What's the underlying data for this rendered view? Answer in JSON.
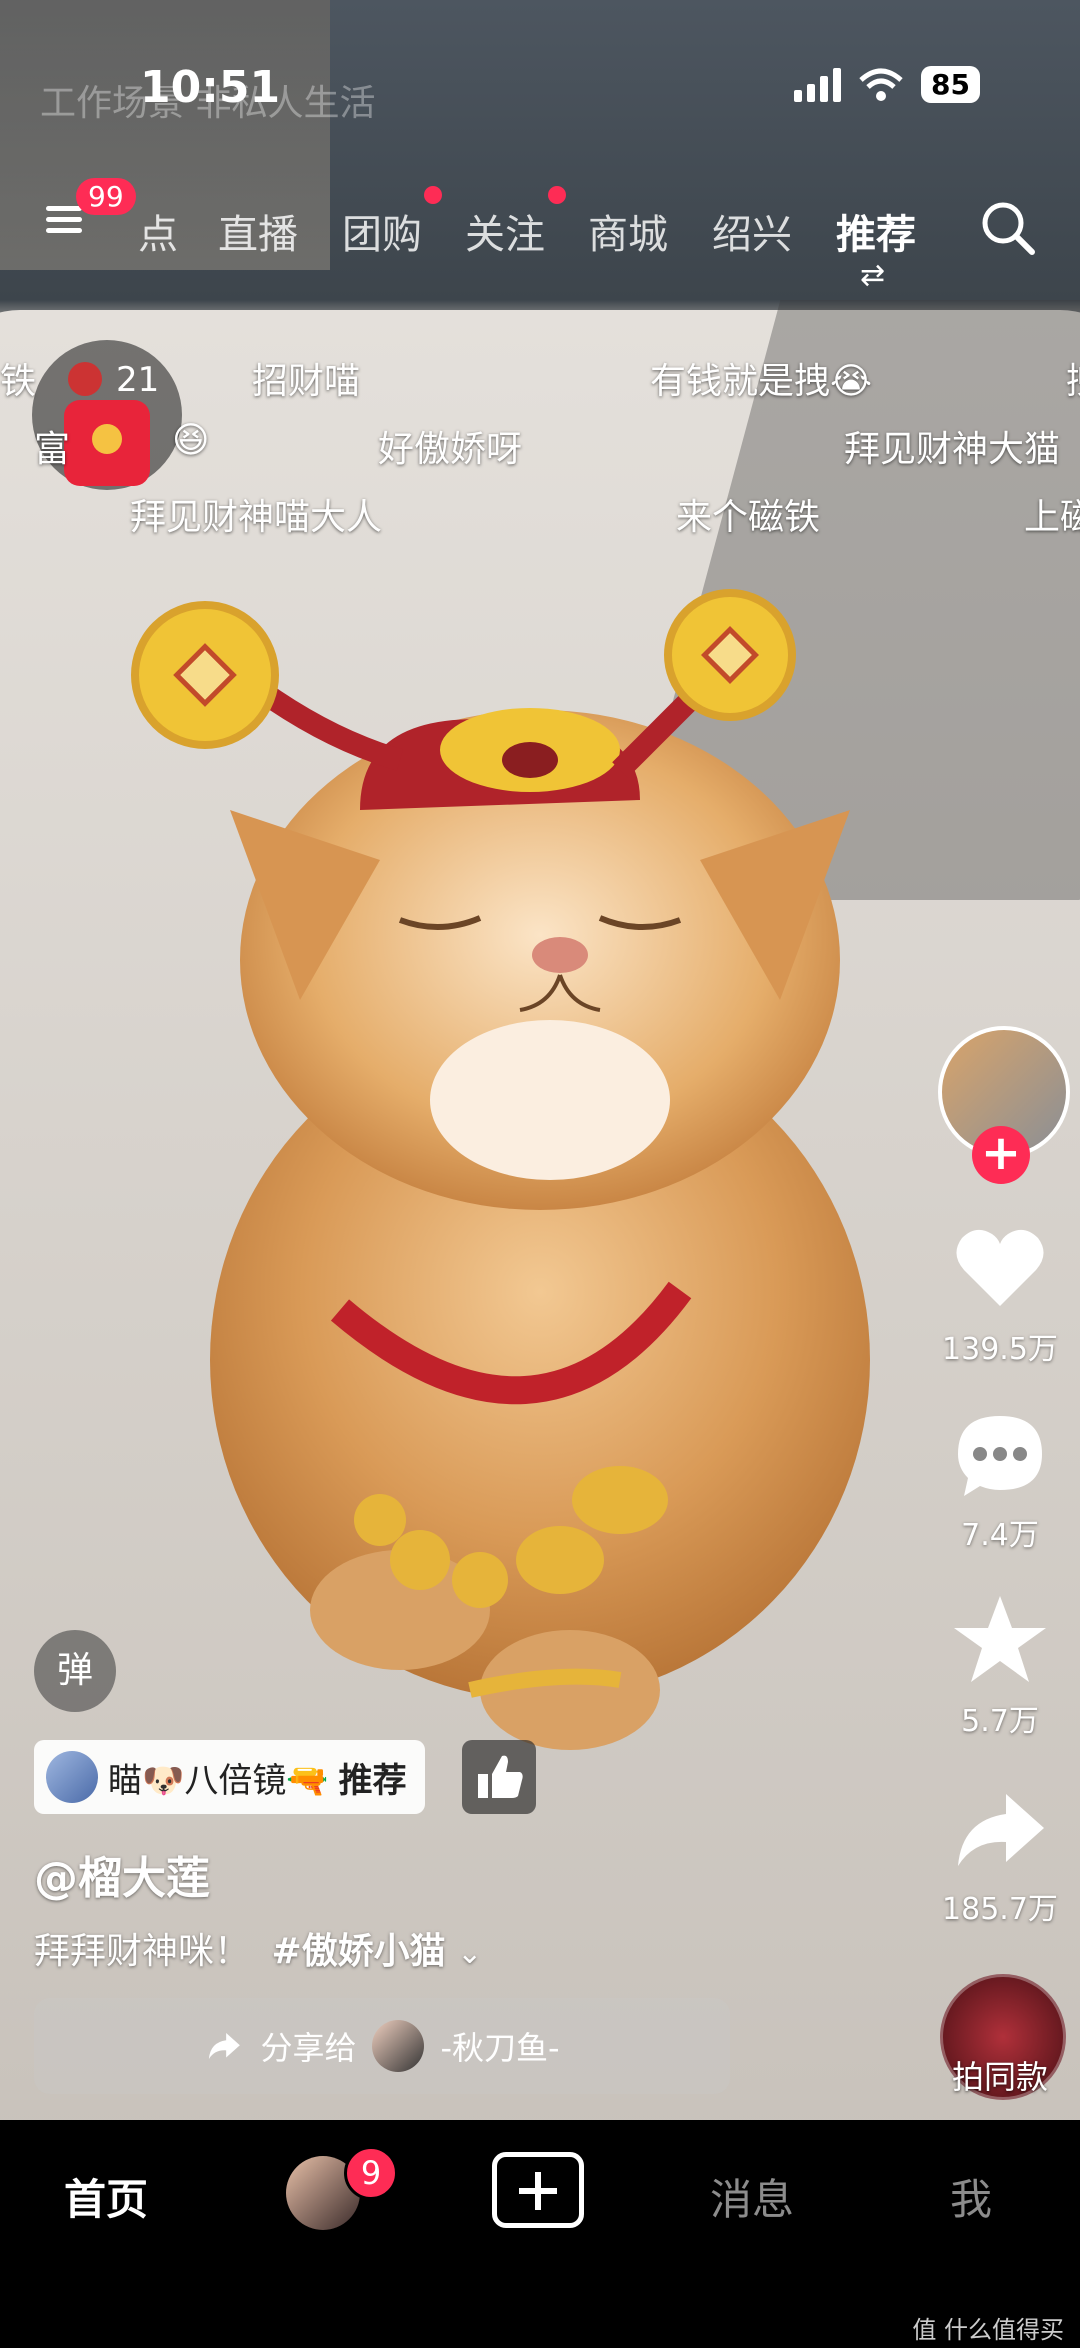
{
  "status_bar": {
    "time": "10:51",
    "battery": "85"
  },
  "background_text": "工作场景  非私人生活",
  "top_nav": {
    "menu_badge": "99",
    "tabs": [
      {
        "label": "点",
        "dot": false
      },
      {
        "label": "直播",
        "dot": false
      },
      {
        "label": "团购",
        "dot": true
      },
      {
        "label": "关注",
        "dot": true
      },
      {
        "label": "商城",
        "dot": false
      },
      {
        "label": "绍兴",
        "dot": false
      },
      {
        "label": "推荐",
        "dot": false,
        "active": true
      }
    ]
  },
  "red_packet": {
    "count": "21"
  },
  "danmaku": [
    "铁",
    "招财喵",
    "有钱就是拽😭",
    "拽",
    "富",
    "😆",
    "好傲娇呀",
    "拜见财神大猫",
    "拜见财神喵大人",
    "来个磁铁",
    "上磁"
  ],
  "actions": {
    "likes": "139.5万",
    "comments": "7.4万",
    "favorites": "5.7万",
    "shares": "185.7万",
    "remix_label": "拍同款"
  },
  "danmu_toggle": "弹",
  "recommend_tag": {
    "text": "瞄🐶八倍镜🔫",
    "action": "推荐"
  },
  "author": "@榴大莲",
  "caption": {
    "text": "拜拜财神咪！",
    "hashtag": "#傲娇小猫"
  },
  "share_bar": {
    "prefix": "分享给",
    "friend": "-秋刀鱼-"
  },
  "bottom_nav": {
    "home": "首页",
    "friends_badge": "9",
    "messages": "消息",
    "me": "我"
  },
  "watermark": "值 什么值得买",
  "colors": {
    "accent": "#fe2c55",
    "gold": "#f5c242"
  }
}
